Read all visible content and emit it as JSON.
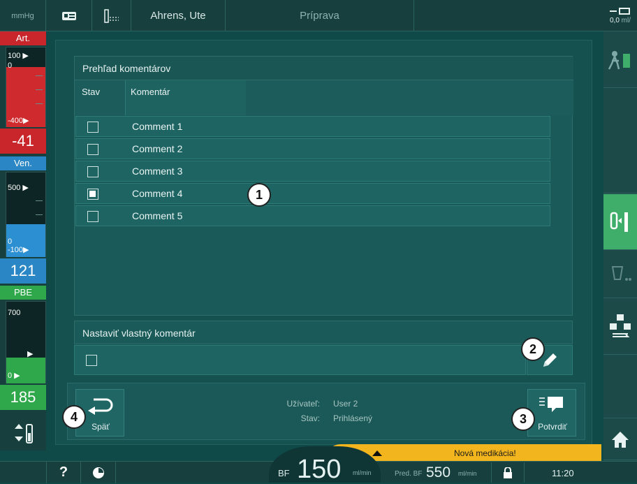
{
  "topbar": {
    "unit": "mmHg",
    "patient_name": "Ahrens, Ute",
    "phase": "Príprava",
    "flow_value": "0,0",
    "flow_unit": "ml/"
  },
  "pressures": {
    "art": {
      "label": "Art.",
      "tick_top": "100",
      "tick_zero": "0",
      "tick_bottom": "-400",
      "value": "-41",
      "color": "#d4262b"
    },
    "ven": {
      "label": "Ven.",
      "tick_top": "500",
      "tick_zero": "0",
      "tick_bottom": "-100",
      "value": "121",
      "color": "#2c8ed0"
    },
    "pbe": {
      "label": "PBE",
      "tick_top": "700",
      "tick_bottom": "0",
      "value": "185",
      "color": "#2ea84a"
    }
  },
  "overview": {
    "title": "Prehľad komentárov",
    "col_status": "Stav",
    "col_comment": "Komentár",
    "comments": [
      {
        "label": "Comment 1",
        "checked": false
      },
      {
        "label": "Comment 2",
        "checked": false
      },
      {
        "label": "Comment 3",
        "checked": false
      },
      {
        "label": "Comment 4",
        "checked": true
      },
      {
        "label": "Comment 5",
        "checked": false
      }
    ]
  },
  "custom": {
    "title": "Nastaviť vlastný komentár"
  },
  "footer": {
    "back_label": "Späť",
    "confirm_label": "Potvrdiť",
    "user_key": "Užívateľ:",
    "user_value": "User 2",
    "status_key": "Stav:",
    "status_value": "Prihlásený"
  },
  "callouts": {
    "c1": "1",
    "c2": "2",
    "c3": "3",
    "c4": "4"
  },
  "alert": {
    "text": "Nová medikácia!"
  },
  "bottom": {
    "bf_label": "BF",
    "bf_value": "150",
    "bf_unit": "ml/min",
    "pred_label": "Pred. BF",
    "pred_value": "550",
    "pred_unit": "ml/min",
    "time": "11:20",
    "help": "?"
  },
  "colors": {
    "accent_green": "#3fae6a",
    "alert_yellow": "#f2b51d"
  }
}
